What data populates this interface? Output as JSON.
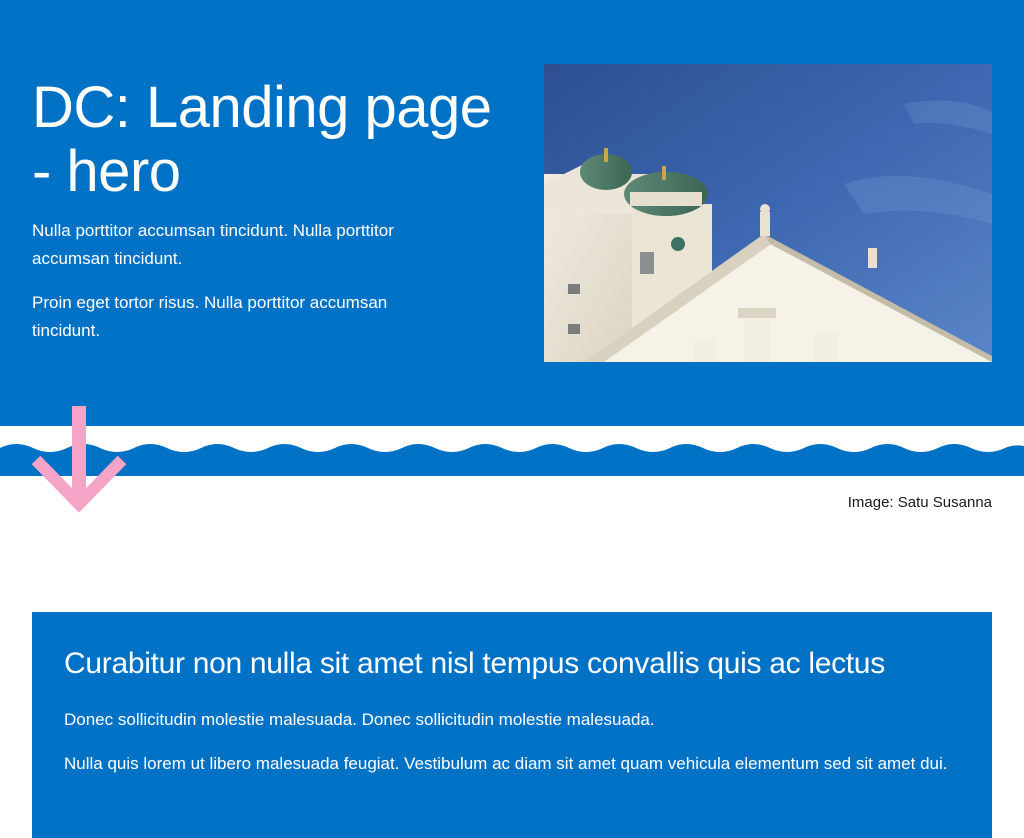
{
  "colors": {
    "brand_blue": "#0072c6",
    "accent_pink": "#f5a3c7",
    "background": "#ffffff",
    "caption_text": "#1a1a1a"
  },
  "hero": {
    "title": "DC: Landing page - hero",
    "paragraphs": [
      "Nulla porttitor accumsan tincidunt. Nulla porttitor accumsan tincidunt.",
      "Proin eget tortor risus. Nulla porttitor accumsan tincidunt."
    ],
    "image_caption": "Image: Satu Susanna"
  },
  "info_box": {
    "title": "Curabitur non nulla sit amet nisl tempus convallis quis ac lectus",
    "paragraphs": [
      "Donec sollicitudin molestie malesuada. Donec sollicitudin molestie malesuada.",
      "Nulla quis lorem ut libero malesuada feugiat. Vestibulum ac diam sit amet quam vehicula elementum sed sit amet dui."
    ]
  },
  "icons": {
    "scroll_down": "arrow-down-icon",
    "wave": "wave-divider"
  }
}
